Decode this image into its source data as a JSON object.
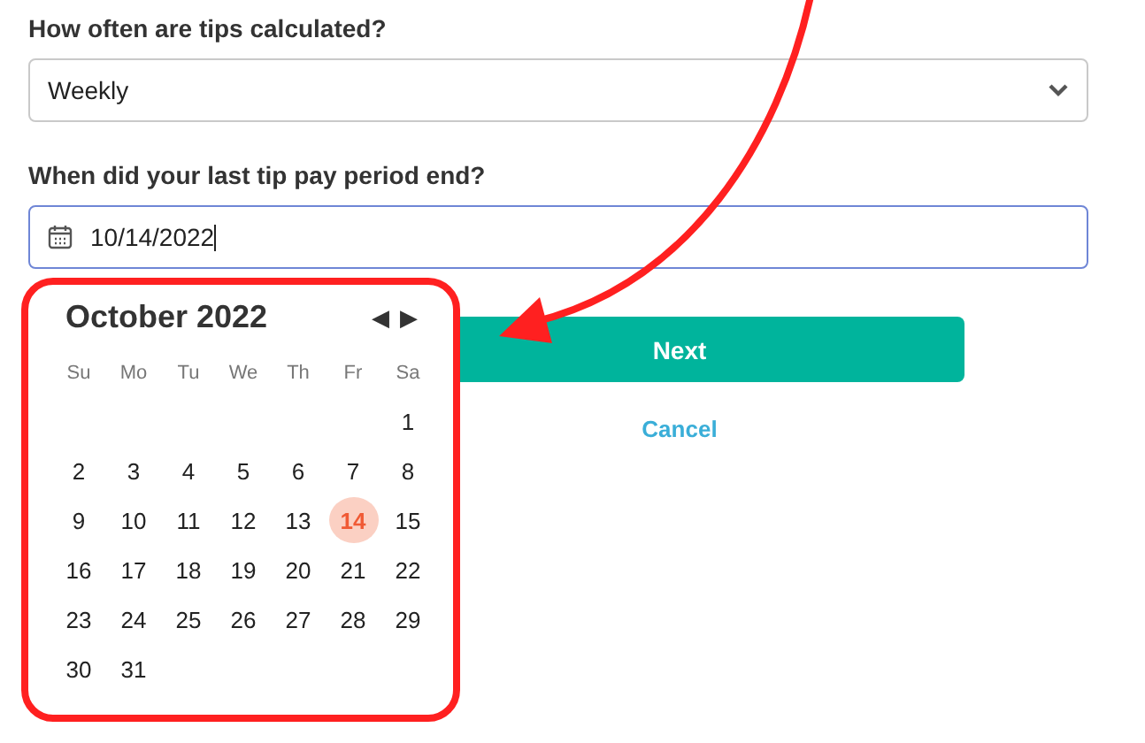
{
  "form": {
    "fields": [
      {
        "kind": "select",
        "label": "How often are tips calculated?",
        "value": "Weekly"
      },
      {
        "kind": "date",
        "label": "When did your last tip pay period end?",
        "value": "10/14/2022",
        "focused": true
      }
    ],
    "next_button": "Next",
    "cancel_link": "Cancel"
  },
  "calendar": {
    "title": "October 2022",
    "prev": "◀",
    "next": "▶",
    "weekdays": [
      "Su",
      "Mo",
      "Tu",
      "We",
      "Th",
      "Fr",
      "Sa"
    ],
    "weeks": [
      [
        {
          "day": "1",
          "selected": false
        }
      ],
      [
        {
          "day": "2",
          "selected": false
        },
        {
          "day": "3",
          "selected": false
        },
        {
          "day": "4",
          "selected": false
        },
        {
          "day": "5",
          "selected": false
        },
        {
          "day": "6",
          "selected": false
        },
        {
          "day": "7",
          "selected": false
        },
        {
          "day": "8",
          "selected": false
        }
      ],
      [
        {
          "day": "9",
          "selected": false
        },
        {
          "day": "10",
          "selected": false
        },
        {
          "day": "11",
          "selected": false
        },
        {
          "day": "12",
          "selected": false
        },
        {
          "day": "13",
          "selected": false
        },
        {
          "day": "14",
          "selected": true
        },
        {
          "day": "15",
          "selected": false
        }
      ],
      [
        {
          "day": "16",
          "selected": false
        },
        {
          "day": "17",
          "selected": false
        },
        {
          "day": "18",
          "selected": false
        },
        {
          "day": "19",
          "selected": false
        },
        {
          "day": "20",
          "selected": false
        },
        {
          "day": "21",
          "selected": false
        },
        {
          "day": "22",
          "selected": false
        }
      ],
      [
        {
          "day": "23",
          "selected": false
        },
        {
          "day": "24",
          "selected": false
        },
        {
          "day": "25",
          "selected": false
        },
        {
          "day": "26",
          "selected": false
        },
        {
          "day": "27",
          "selected": false
        },
        {
          "day": "28",
          "selected": false
        },
        {
          "day": "29",
          "selected": false
        }
      ],
      [
        {
          "day": "30",
          "selected": false
        },
        {
          "day": "31",
          "selected": false
        }
      ]
    ]
  }
}
